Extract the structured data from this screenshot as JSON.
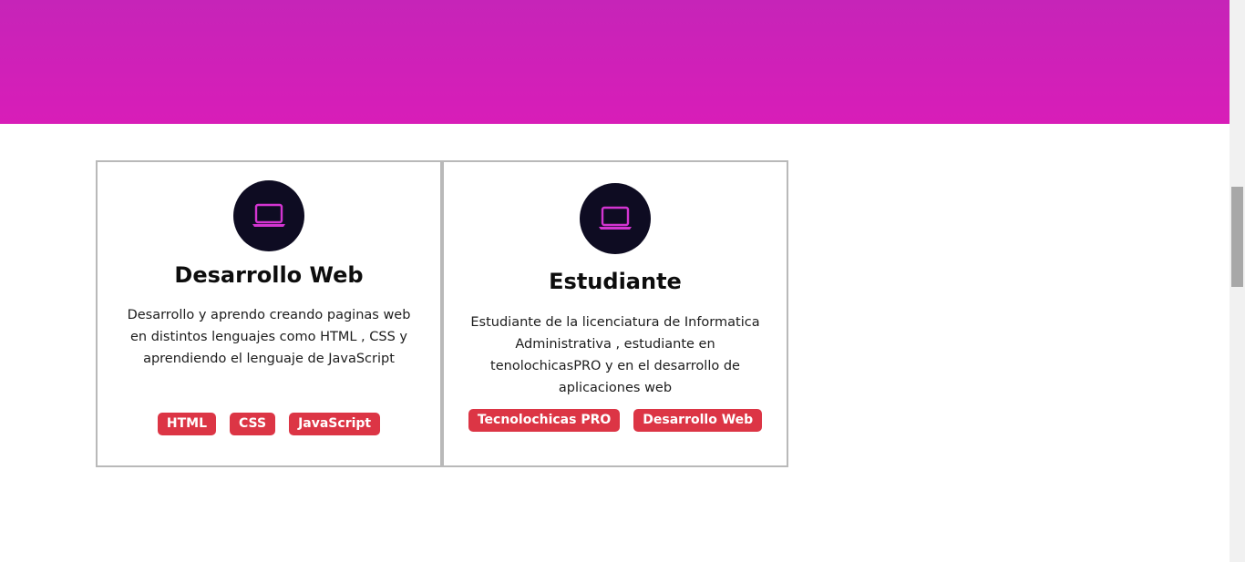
{
  "colors": {
    "banner_top": "#c624b8",
    "banner_bottom": "#d81db8",
    "icon_background": "#0e0c22",
    "icon_accent": "#d335d1",
    "tag_background": "#dc3545",
    "card_border": "#b9b9b9"
  },
  "cards": [
    {
      "icon": "laptop-icon",
      "title": "Desarrollo Web",
      "description": "Desarrollo y aprendo creando paginas web en distintos lenguajes como HTML , CSS y aprendiendo el lenguaje de JavaScript",
      "tags": [
        "HTML",
        "CSS",
        "JavaScript"
      ]
    },
    {
      "icon": "laptop-icon",
      "title": "Estudiante",
      "description": "Estudiante de la licenciatura de Informatica Administrativa , estudiante en tenolochicasPRO y en el desarrollo de aplicaciones web",
      "tags": [
        "Tecnolochicas PRO",
        "Desarrollo Web"
      ]
    }
  ]
}
